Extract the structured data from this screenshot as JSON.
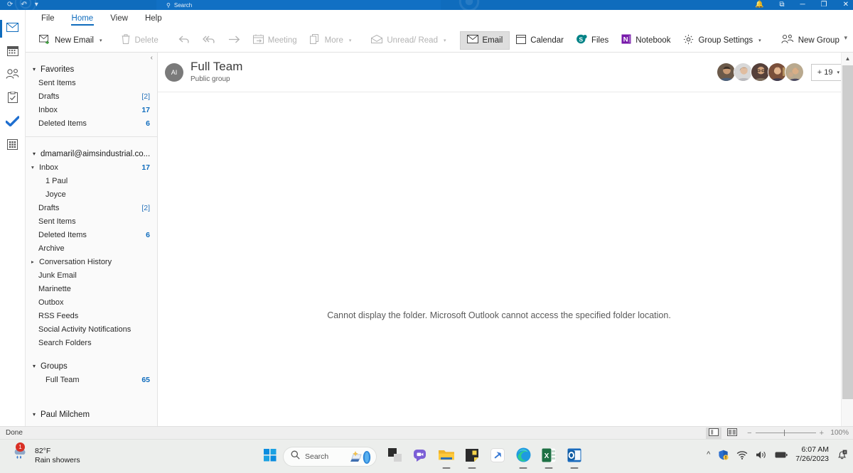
{
  "titlebar": {
    "qat": [
      {
        "name": "sync-icon",
        "glyph": "⟳"
      },
      {
        "name": "undo-icon",
        "glyph": "↶"
      },
      {
        "name": "qat-more-icon",
        "glyph": "▾"
      }
    ],
    "window_controls": [
      {
        "name": "notifications-icon",
        "glyph": "🔔"
      },
      {
        "name": "restore-layout-icon",
        "glyph": "⧉"
      },
      {
        "name": "minimize-icon",
        "glyph": "─"
      },
      {
        "name": "maximize-icon",
        "glyph": "❐"
      },
      {
        "name": "close-icon",
        "glyph": "✕"
      }
    ]
  },
  "search": {
    "placeholder": "Search",
    "icon": "search-icon"
  },
  "rail": [
    {
      "name": "mail",
      "icon": "mail-icon",
      "active": true
    },
    {
      "name": "calendar",
      "icon": "calendar-icon",
      "active": false
    },
    {
      "name": "people",
      "icon": "people-icon",
      "active": false
    },
    {
      "name": "tasks",
      "icon": "tasks-icon",
      "active": false
    },
    {
      "name": "todo",
      "icon": "todo-check-icon",
      "active": false
    },
    {
      "name": "more-apps",
      "icon": "apps-grid-icon",
      "active": false
    }
  ],
  "ribbon": {
    "tabs": [
      {
        "label": "File",
        "active": false
      },
      {
        "label": "Home",
        "active": true
      },
      {
        "label": "View",
        "active": false
      },
      {
        "label": "Help",
        "active": false
      }
    ],
    "commands": [
      {
        "label": "New Email",
        "icon": "new-email-icon",
        "caret": true,
        "state": "normal"
      },
      {
        "label": "Delete",
        "icon": "trash-icon",
        "caret": false,
        "state": "disabled"
      },
      {
        "label": "",
        "icon": "reply-icon",
        "caret": false,
        "state": "disabled"
      },
      {
        "label": "",
        "icon": "reply-all-icon",
        "caret": false,
        "state": "disabled"
      },
      {
        "label": "",
        "icon": "forward-icon",
        "caret": false,
        "state": "disabled"
      },
      {
        "label": "Meeting",
        "icon": "meeting-icon",
        "caret": false,
        "state": "disabled"
      },
      {
        "label": "More",
        "icon": "more-move-icon",
        "caret": true,
        "state": "disabled"
      },
      {
        "label": "Unread/ Read",
        "icon": "unread-read-icon",
        "caret": true,
        "state": "disabled"
      },
      {
        "label": "Email",
        "icon": "email-view-icon",
        "caret": false,
        "state": "selected"
      },
      {
        "label": "Calendar",
        "icon": "calendar-view-icon",
        "caret": false,
        "state": "normal"
      },
      {
        "label": "Files",
        "icon": "files-sharepoint-icon",
        "caret": false,
        "state": "normal"
      },
      {
        "label": "Notebook",
        "icon": "onenote-icon",
        "caret": false,
        "state": "normal"
      },
      {
        "label": "Group Settings",
        "icon": "gear-icon",
        "caret": true,
        "state": "normal"
      },
      {
        "label": "New Group",
        "icon": "new-group-icon",
        "caret": false,
        "state": "normal"
      },
      {
        "label": "",
        "icon": "overflow-ellipsis-icon",
        "caret": false,
        "state": "normal"
      }
    ],
    "collapse_icon": "chevron-down-icon"
  },
  "folderpane": {
    "collapse_icon": "chevron-left-icon",
    "sections": [
      {
        "name": "favorites",
        "header": "Favorites",
        "expanded": true,
        "items": [
          {
            "label": "Sent Items",
            "count": ""
          },
          {
            "label": "Drafts",
            "count": "[2]",
            "style": "draft"
          },
          {
            "label": "Inbox",
            "count": "17"
          },
          {
            "label": "Deleted Items",
            "count": "6"
          }
        ]
      },
      {
        "name": "account",
        "header": "dmamaril@aimsindustrial.co...",
        "expanded": true,
        "items": [
          {
            "label": "Inbox",
            "count": "17",
            "expandable": true,
            "expanded": true
          },
          {
            "label": "1 Paul",
            "count": "",
            "sub": true
          },
          {
            "label": "Joyce",
            "count": "",
            "sub": true
          },
          {
            "label": "Drafts",
            "count": "[2]",
            "style": "draft"
          },
          {
            "label": "Sent Items",
            "count": ""
          },
          {
            "label": "Deleted Items",
            "count": "6"
          },
          {
            "label": "Archive",
            "count": ""
          },
          {
            "label": "Conversation History",
            "count": "",
            "expandable": true,
            "expanded": false
          },
          {
            "label": "Junk Email",
            "count": ""
          },
          {
            "label": "Marinette",
            "count": ""
          },
          {
            "label": "Outbox",
            "count": ""
          },
          {
            "label": "RSS Feeds",
            "count": ""
          },
          {
            "label": "Social Activity Notifications",
            "count": ""
          },
          {
            "label": "Search Folders",
            "count": ""
          }
        ]
      },
      {
        "name": "groups",
        "header": "Groups",
        "expanded": true,
        "items": [
          {
            "label": "Full Team",
            "count": "65",
            "sub": true
          }
        ]
      },
      {
        "name": "paul-milchem",
        "header": "Paul Milchem",
        "expanded": true,
        "items": []
      }
    ]
  },
  "group": {
    "avatar_initials": "AI",
    "title": "Full Team",
    "subtitle": "Public group",
    "members_overflow": "+ 19",
    "members_caret": "chevron-down-icon",
    "member_avatars": [
      {
        "name": "member-avatar-1",
        "bg": "#6b5a4a",
        "skin": "#c89a74",
        "hair": "#3b2f26"
      },
      {
        "name": "member-avatar-2",
        "bg": "#d8d8d8",
        "skin": "#e0bda0",
        "hair": "#4a3b33"
      },
      {
        "name": "member-avatar-3",
        "bg": "#55403a",
        "skin": "#d3a47e",
        "hair": "#2b211c"
      },
      {
        "name": "member-avatar-4",
        "bg": "#7a4f3a",
        "skin": "#e2b48e",
        "hair": "#241a16"
      },
      {
        "name": "member-avatar-5",
        "bg": "#b9a98e",
        "skin": "#d9ae86",
        "hair": "#3a2e26"
      }
    ]
  },
  "reading_pane": {
    "message": "Cannot display the folder. Microsoft Outlook cannot access the specified folder location."
  },
  "statusbar": {
    "status_text": "Done",
    "view_normal_icon": "normal-view-icon",
    "view_reading_icon": "reading-view-icon",
    "zoom_out": "−",
    "zoom_in": "+",
    "zoom_level": "100%"
  },
  "taskbar": {
    "weather": {
      "badge": "1",
      "temperature": "82°F",
      "condition": "Rain showers",
      "icon": "rain-cloud-icon"
    },
    "start_icon": "windows-start-icon",
    "search_placeholder": "Search",
    "apps": [
      {
        "name": "copilot-icon",
        "running": false
      },
      {
        "name": "task-view-icon",
        "running": false
      },
      {
        "name": "chat-teams-icon",
        "running": false
      },
      {
        "name": "file-explorer-icon",
        "running": true
      },
      {
        "name": "sticky-notes-icon",
        "running": true
      },
      {
        "name": "snip-tool-icon",
        "running": false
      },
      {
        "name": "edge-icon",
        "running": true
      },
      {
        "name": "excel-icon",
        "running": true
      },
      {
        "name": "outlook-icon",
        "running": true
      }
    ],
    "tray": [
      {
        "name": "show-hidden-icons-icon",
        "glyph": "˄"
      },
      {
        "name": "security-shield-icon"
      },
      {
        "name": "wifi-icon"
      },
      {
        "name": "volume-icon"
      },
      {
        "name": "battery-icon"
      }
    ],
    "clock": {
      "time": "6:07 AM",
      "date": "7/26/2023"
    },
    "notification_icon": "notification-bell-icon"
  },
  "colors": {
    "accent": "#0f6cbd",
    "titlebar": "#0f6cbd",
    "count_blue": "#0f6cbd",
    "folderpane_bg": "#fafafa",
    "taskbar_bg": "#eceeec"
  }
}
